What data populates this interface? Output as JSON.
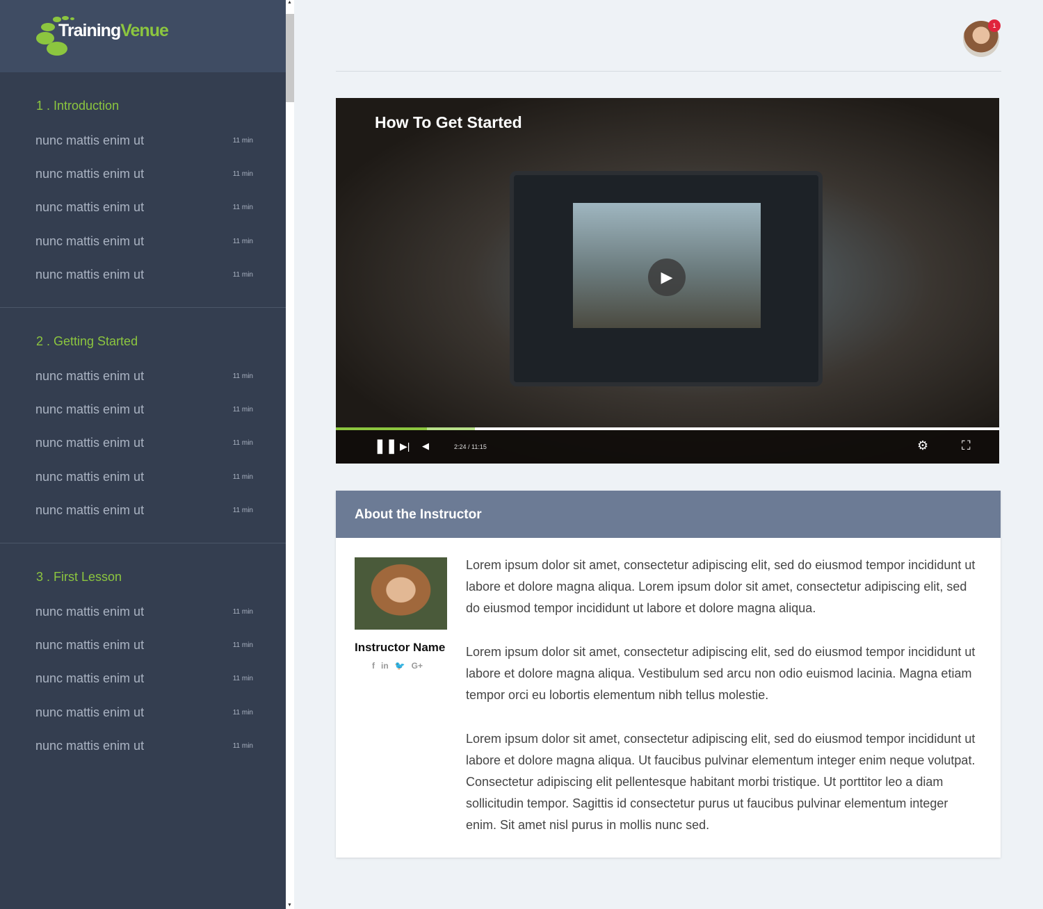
{
  "brand": {
    "part1": "Training",
    "part2": "Venue"
  },
  "sections": [
    {
      "title": "1 . Introduction",
      "items": [
        {
          "label": "nunc mattis enim ut",
          "duration": "11 min"
        },
        {
          "label": "nunc mattis enim ut",
          "duration": "11 min"
        },
        {
          "label": "nunc mattis enim ut",
          "duration": "11 min"
        },
        {
          "label": "nunc mattis enim ut",
          "duration": "11 min"
        },
        {
          "label": "nunc mattis enim ut",
          "duration": "11 min"
        }
      ]
    },
    {
      "title": "2 . Getting Started",
      "items": [
        {
          "label": "nunc mattis enim ut",
          "duration": "11 min"
        },
        {
          "label": "nunc mattis enim ut",
          "duration": "11 min"
        },
        {
          "label": "nunc mattis enim ut",
          "duration": "11 min"
        },
        {
          "label": "nunc mattis enim ut",
          "duration": "11 min"
        },
        {
          "label": "nunc mattis enim ut",
          "duration": "11 min"
        }
      ]
    },
    {
      "title": "3 . First Lesson",
      "items": [
        {
          "label": "nunc mattis enim ut",
          "duration": "11 min"
        },
        {
          "label": "nunc mattis enim ut",
          "duration": "11 min"
        },
        {
          "label": "nunc mattis enim ut",
          "duration": "11 min"
        },
        {
          "label": "nunc mattis enim ut",
          "duration": "11 min"
        },
        {
          "label": "nunc mattis enim ut",
          "duration": "11 min"
        }
      ]
    }
  ],
  "header": {
    "notification_count": "1"
  },
  "video": {
    "title": "How To Get Started",
    "time": "2:24 / 11:15",
    "played_fraction": 0.137,
    "buffered_fraction": 0.21
  },
  "instructor": {
    "heading": "About the Instructor",
    "name": "Instructor Name",
    "social": [
      "f",
      "in",
      "🐦",
      "G+"
    ],
    "paragraphs": [
      "Lorem ipsum dolor sit amet, consectetur adipiscing elit, sed do eiusmod tempor incididunt ut labore et dolore magna aliqua. Lorem ipsum dolor sit amet, consectetur adipiscing elit, sed do eiusmod tempor incididunt ut labore et dolore magna aliqua.",
      "Lorem ipsum dolor sit amet, consectetur adipiscing elit, sed do eiusmod tempor incididunt ut labore et dolore magna aliqua. Vestibulum sed arcu non odio euismod lacinia. Magna etiam tempor orci eu lobortis elementum nibh tellus molestie.",
      "Lorem ipsum dolor sit amet, consectetur adipiscing elit, sed do eiusmod tempor incididunt ut labore et dolore magna aliqua. Ut faucibus pulvinar elementum integer enim neque volutpat. Consectetur adipiscing elit pellentesque habitant morbi tristique. Ut porttitor leo a diam sollicitudin tempor. Sagittis id consectetur purus ut faucibus pulvinar elementum integer enim. Sit amet nisl purus in mollis nunc sed."
    ]
  },
  "colors": {
    "accent": "#8cc63f",
    "sidebar": "#343e50",
    "card_header": "#6c7b95"
  }
}
